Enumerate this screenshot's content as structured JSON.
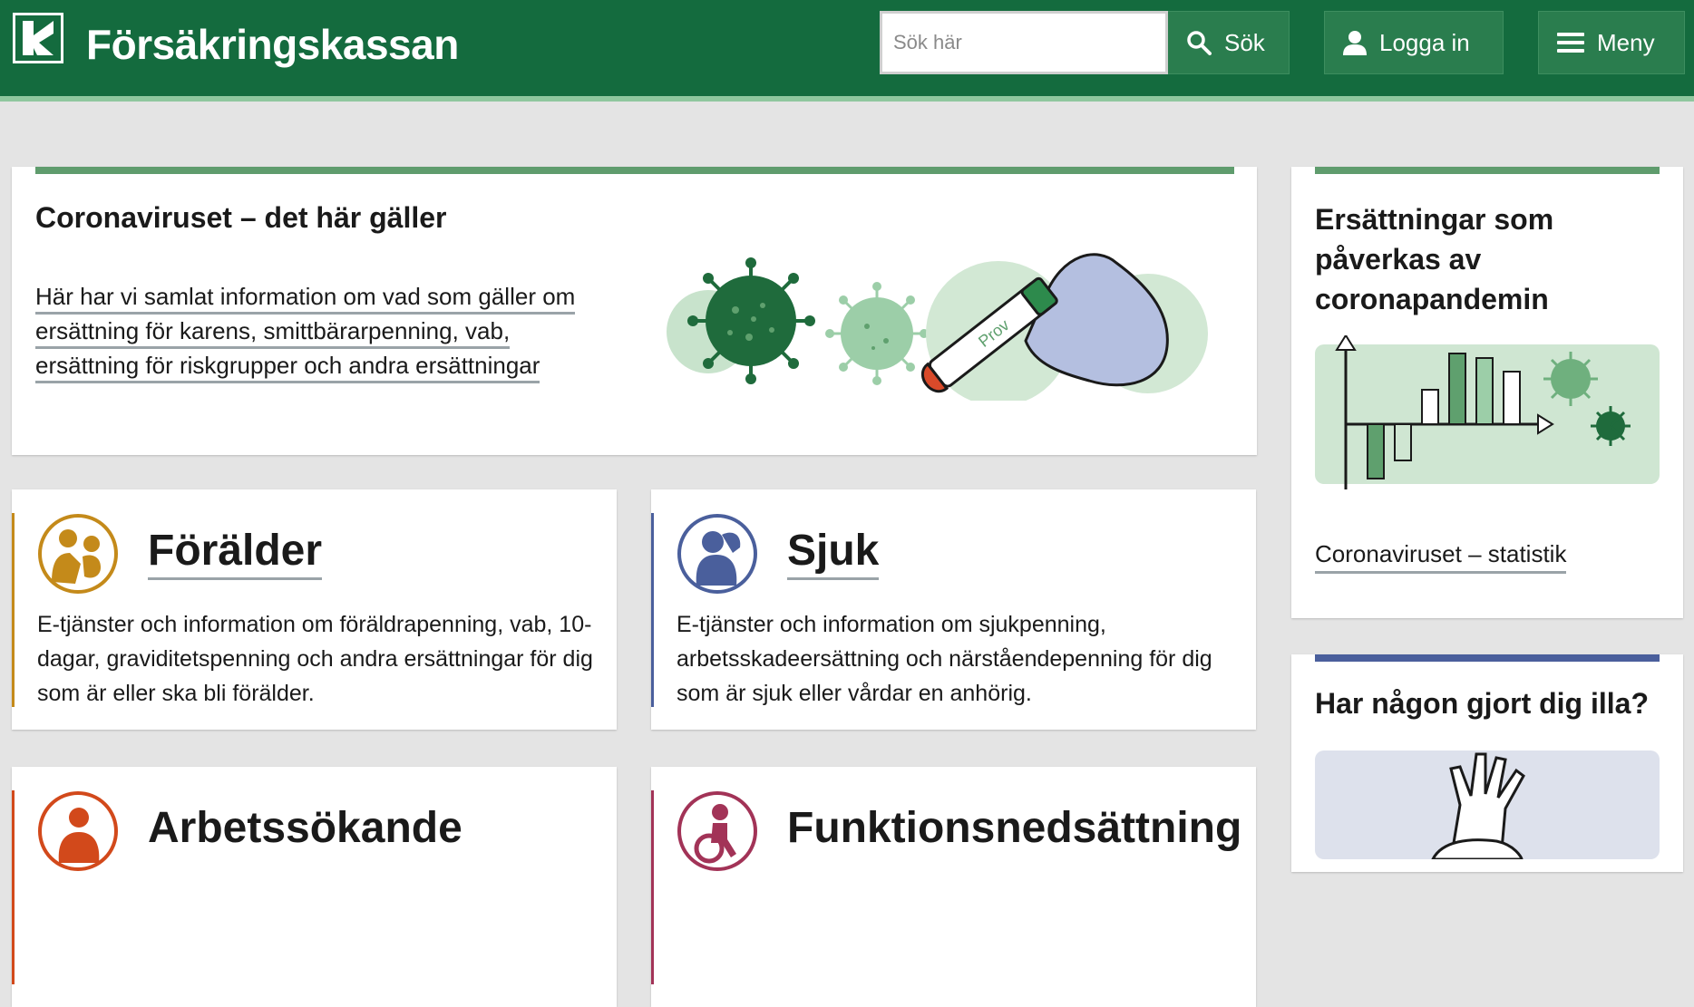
{
  "header": {
    "logo_text": "Försäkringskassan",
    "search": {
      "placeholder": "Sök här",
      "value": ""
    },
    "search_button": "Sök",
    "login_button": "Logga in",
    "menu_button": "Meny",
    "colors": {
      "background": "#146b3e",
      "stripe": "#8fc79e"
    }
  },
  "corona_card": {
    "title": "Coronaviruset – det här gäller",
    "link_text": "Här har vi samlat information om vad som gäller om ersättning för karens, smittbärarpenning, vab, ersättning för riskgrupper och andra ersättningar",
    "illustration_label": "Prov",
    "accent_color": "#5f9c6d"
  },
  "topics": [
    {
      "title": "Förälder",
      "description": "E-tjänster och information om föräldrapenning, vab, 10-dagar, graviditetspenning och andra ersättningar för dig som är eller ska bli förälder.",
      "icon": "parent-icon",
      "color": "#c48a1a"
    },
    {
      "title": "Sjuk",
      "description": "E-tjänster och information om sjukpenning, arbetsskadeersättning och närståendepenning för dig som är sjuk eller vårdar en anhörig.",
      "icon": "sick-person-icon",
      "color": "#4a5f9c"
    },
    {
      "title": "Arbetssökande",
      "icon": "job-seeker-icon",
      "color": "#d2491b"
    },
    {
      "title": "Funktionsnedsättning",
      "icon": "wheelchair-icon",
      "color": "#a23357"
    }
  ],
  "side_card": {
    "title": "Ersättningar som påverkas av coronapandemin",
    "link_text": "Coronaviruset – statistik",
    "accent_color": "#5f9c6d"
  },
  "side_card_2": {
    "title": "Har någon gjort dig illa?",
    "accent_color": "#4a5f9c"
  }
}
